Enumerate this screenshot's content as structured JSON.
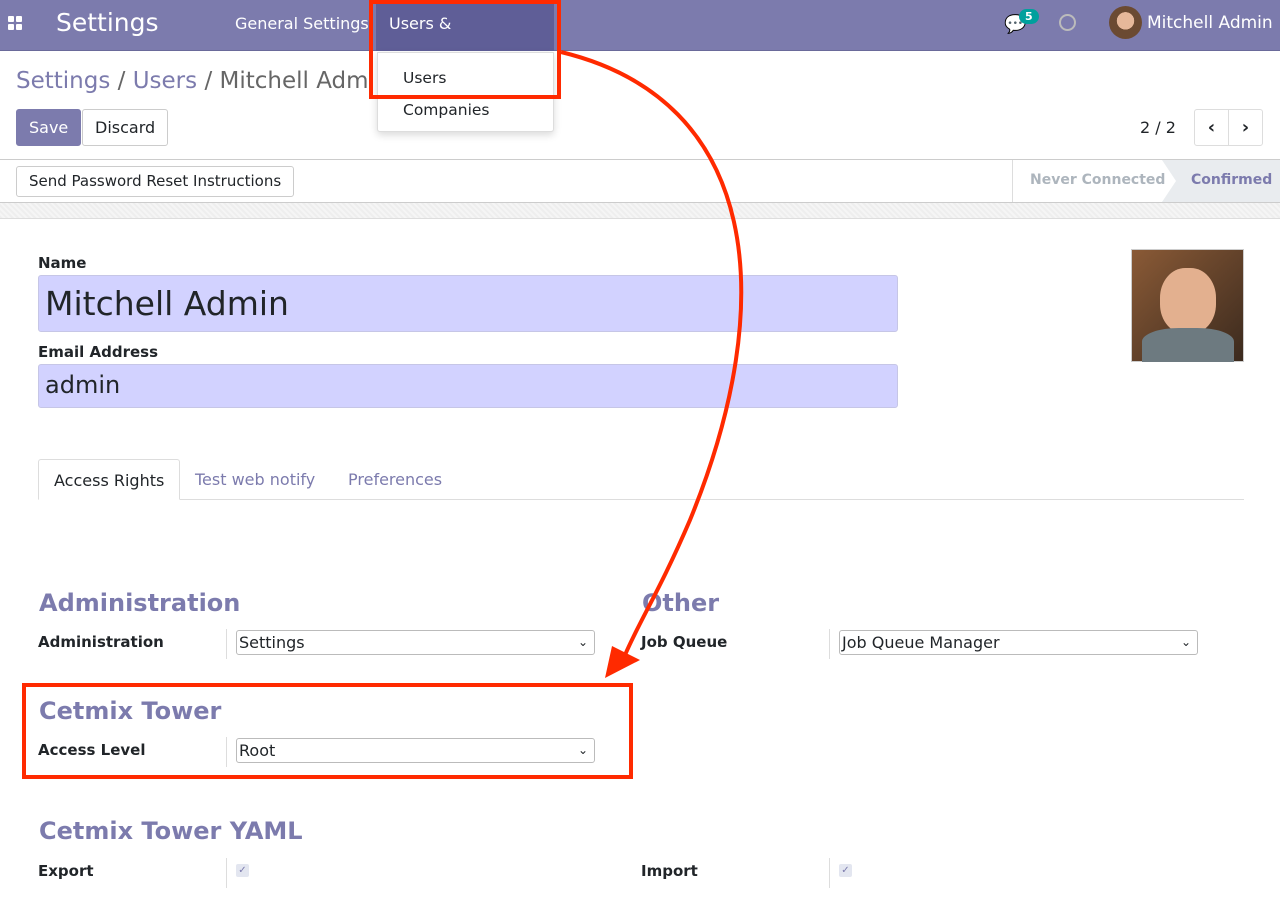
{
  "topbar": {
    "app_title": "Settings",
    "menus": [
      "General Settings",
      "Users & Companies"
    ],
    "active_menu": "Users & Companies",
    "messages_badge": "5",
    "user_name": "Mitchell Admin",
    "icons": [
      "apps-grid-icon",
      "chat-icon",
      "clock-icon",
      "avatar"
    ]
  },
  "dropdown": {
    "items": [
      "Users",
      "Companies"
    ]
  },
  "breadcrumb": {
    "items": [
      "Settings",
      "Users"
    ],
    "current": "Mitchell Admin"
  },
  "actions": {
    "save": "Save",
    "discard": "Discard"
  },
  "pager": {
    "value": "2 / 2"
  },
  "statusbar": {
    "button": "Send Password Reset Instructions",
    "stages": [
      "Never Connected",
      "Confirmed"
    ],
    "active_stage": "Confirmed"
  },
  "form": {
    "name_label": "Name",
    "name_value": "Mitchell Admin",
    "email_label": "Email Address",
    "email_value": "admin"
  },
  "tabs": {
    "items": [
      "Access Rights",
      "Test web notify",
      "Preferences"
    ],
    "active": "Access Rights"
  },
  "sections": {
    "administration": {
      "title": "Administration",
      "label": "Administration",
      "value": "Settings"
    },
    "other": {
      "title": "Other",
      "label": "Job Queue",
      "value": "Job Queue Manager"
    },
    "tower": {
      "title": "Cetmix Tower",
      "label": "Access Level",
      "value": "Root"
    },
    "yaml": {
      "title": "Cetmix Tower YAML",
      "export_label": "Export",
      "export_checked": true,
      "import_label": "Import",
      "import_checked": true
    }
  },
  "colors": {
    "brand": "#7c7bad",
    "field_bg": "#d2d2ff",
    "badge": "#00a09d",
    "annotation": "#ff2a00"
  }
}
